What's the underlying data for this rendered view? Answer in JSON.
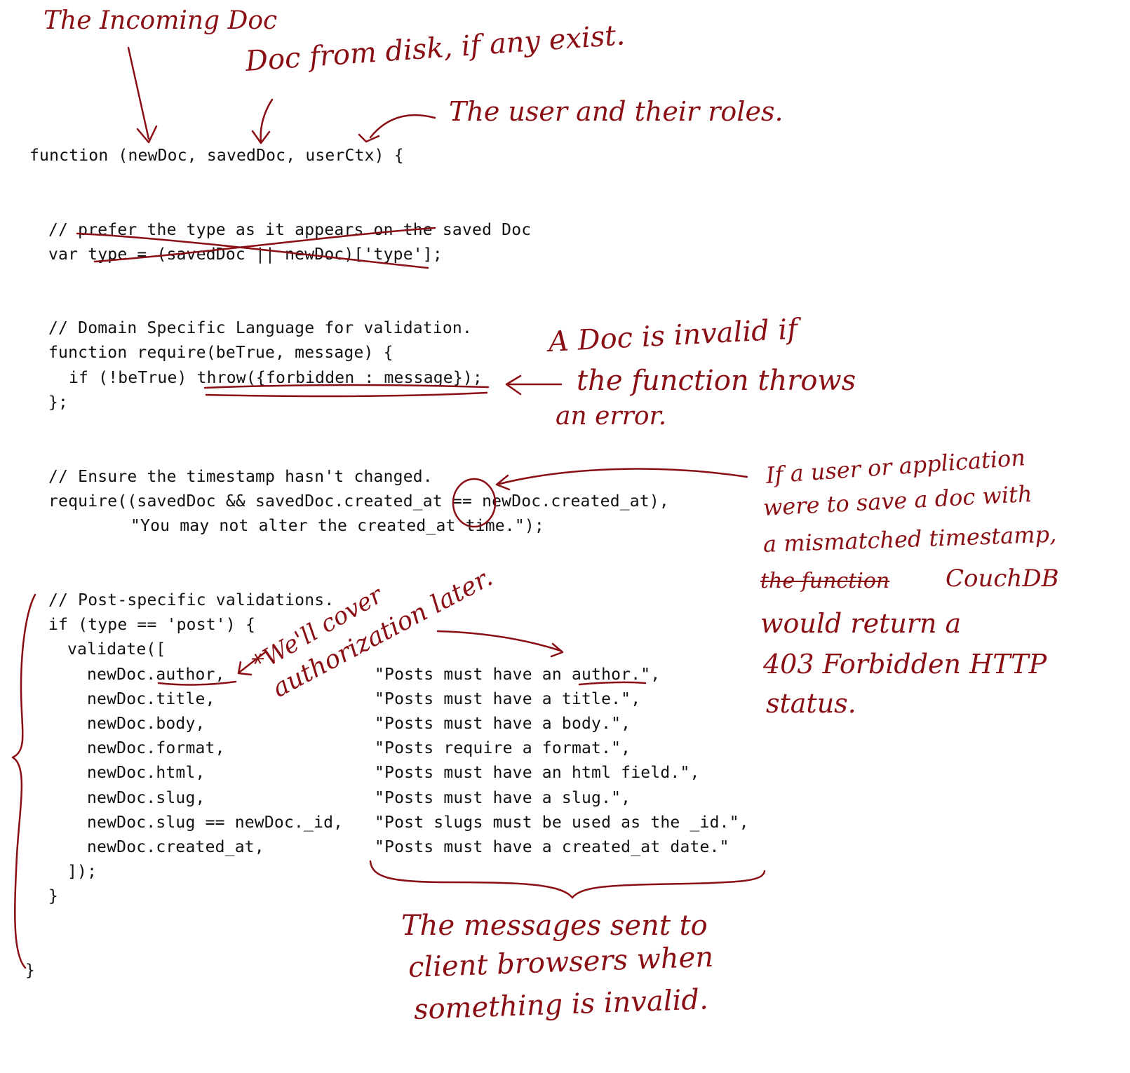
{
  "ink_color": "#8a0f14",
  "code": {
    "signature": "function (newDoc, savedDoc, userCtx) {",
    "type_comment": "// prefer the type as it appears on the saved Doc",
    "type_line": "var type = (savedDoc || newDoc)['type'];",
    "dsl_comment": "// Domain Specific Language for validation.",
    "require_def": "function require(beTrue, message) {",
    "require_if": "if (!beTrue) throw({forbidden : message});",
    "require_close": "};",
    "ts_comment": "// Ensure the timestamp hasn't changed.",
    "ts_require": "require((savedDoc && savedDoc.created_at == newDoc.created_at),",
    "ts_message": "\"You may not alter the created_at time.\");",
    "post_comment": "// Post-specific validations.",
    "post_if": "if (type == 'post') {",
    "validate_open": "validate([",
    "validations": [
      {
        "field": "newDoc.author,",
        "message": "\"Posts must have an author.\","
      },
      {
        "field": "newDoc.title,",
        "message": "\"Posts must have a title.\","
      },
      {
        "field": "newDoc.body,",
        "message": "\"Posts must have a body.\","
      },
      {
        "field": "newDoc.format,",
        "message": "\"Posts require a format.\","
      },
      {
        "field": "newDoc.html,",
        "message": "\"Posts must have an html field.\","
      },
      {
        "field": "newDoc.slug,",
        "message": "\"Posts must have a slug.\","
      },
      {
        "field": "newDoc.slug == newDoc._id,",
        "message": "\"Post slugs must be used as the _id.\","
      },
      {
        "field": "newDoc.created_at,",
        "message": "\"Posts must have a created_at date.\""
      }
    ],
    "validate_close": "]);",
    "if_close": "}",
    "fn_close": "}"
  },
  "annotations": {
    "incoming_doc": "The Incoming Doc",
    "saved_doc": "Doc from disk, if any exist.",
    "user_ctx": "The user and their roles.",
    "invalid_doc": [
      "A Doc is invalid if",
      "the function throws",
      "an error."
    ],
    "timestamp_note": [
      "If a user or application",
      "were to save a doc with",
      "a mismatched timestamp,",
      "the function",
      "CouchDB",
      "would return a",
      "403 Forbidden HTTP",
      "status."
    ],
    "authorization": [
      "*We'll cover",
      "authorization later."
    ],
    "messages_note": [
      "The messages sent to",
      "client browsers when",
      "something is invalid."
    ]
  }
}
